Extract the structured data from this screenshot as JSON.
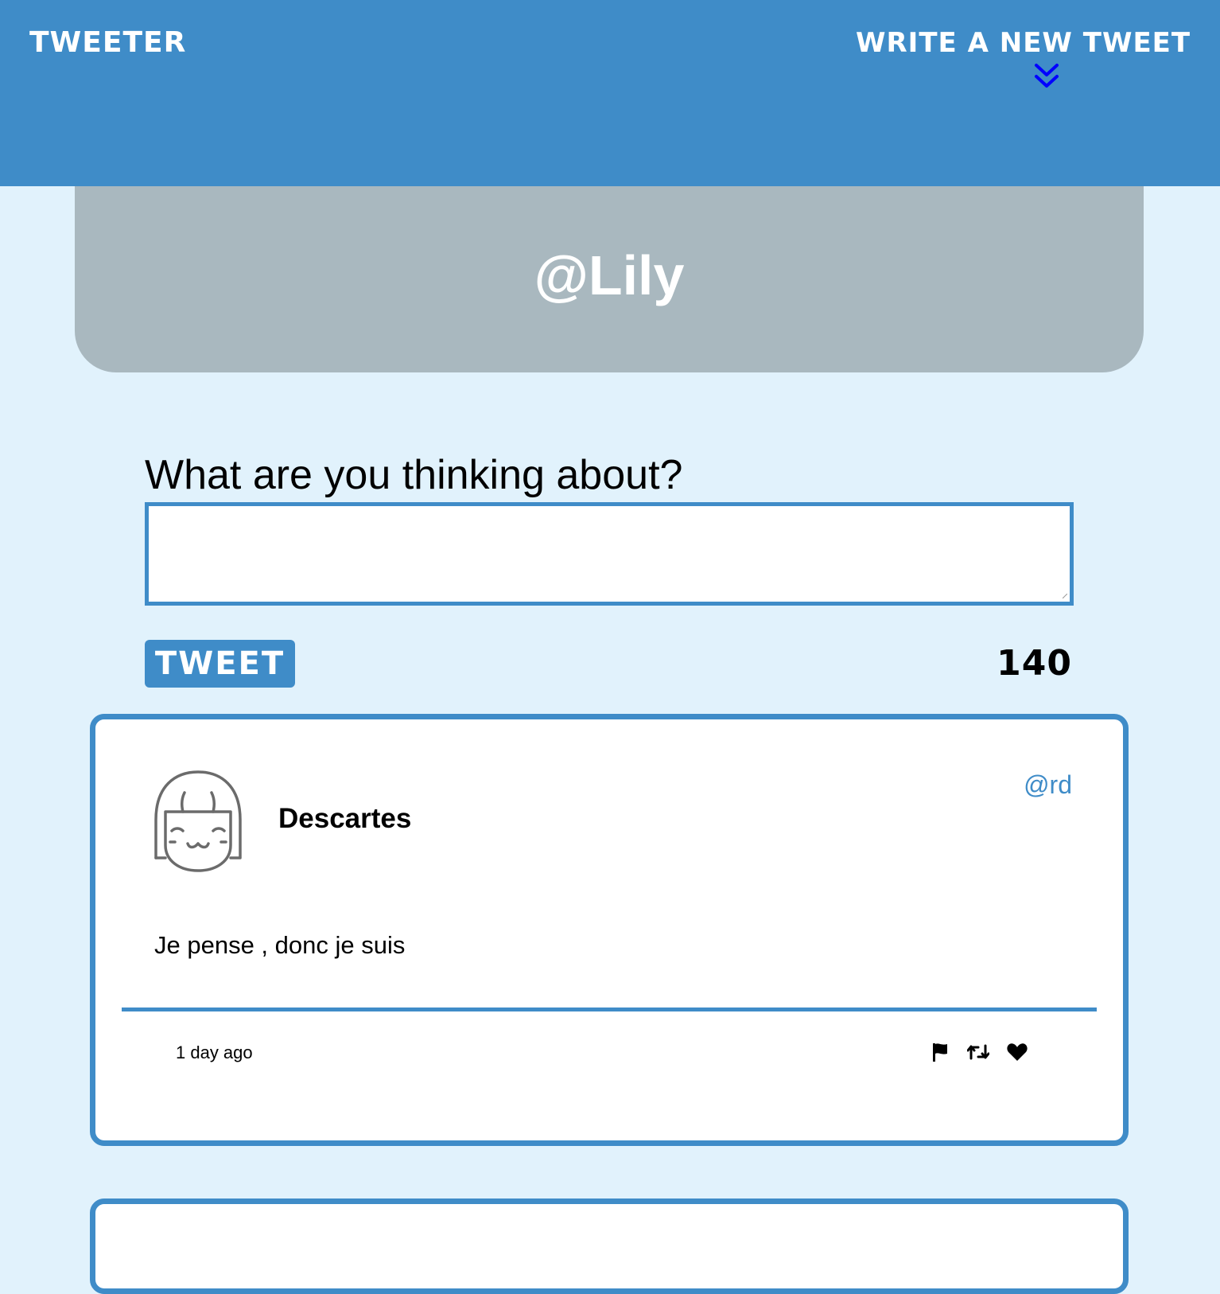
{
  "nav": {
    "brand": "TWEETER",
    "compose_toggle": "WRITE A NEW TWEET",
    "compose_toggle_icon": "double-chevron-down-icon"
  },
  "profile": {
    "handle": "@Lily"
  },
  "compose": {
    "label": "What are you thinking about?",
    "value": "",
    "placeholder": "",
    "submit_label": "TWEET",
    "char_counter": "140"
  },
  "tweets": [
    {
      "avatar_icon": "girl-face-avatar-icon",
      "name": "Descartes",
      "handle": "@rd",
      "text": "Je pense , donc je suis",
      "time": "1 day ago",
      "actions": [
        "flag-icon",
        "retweet-icon",
        "heart-icon"
      ]
    }
  ],
  "colors": {
    "nav_bg": "#3f8cc8",
    "page_bg": "#e1f2fc",
    "profile_bg": "#a9b8bf",
    "accent": "#3f8cc8",
    "chevron": "#0000ff"
  }
}
